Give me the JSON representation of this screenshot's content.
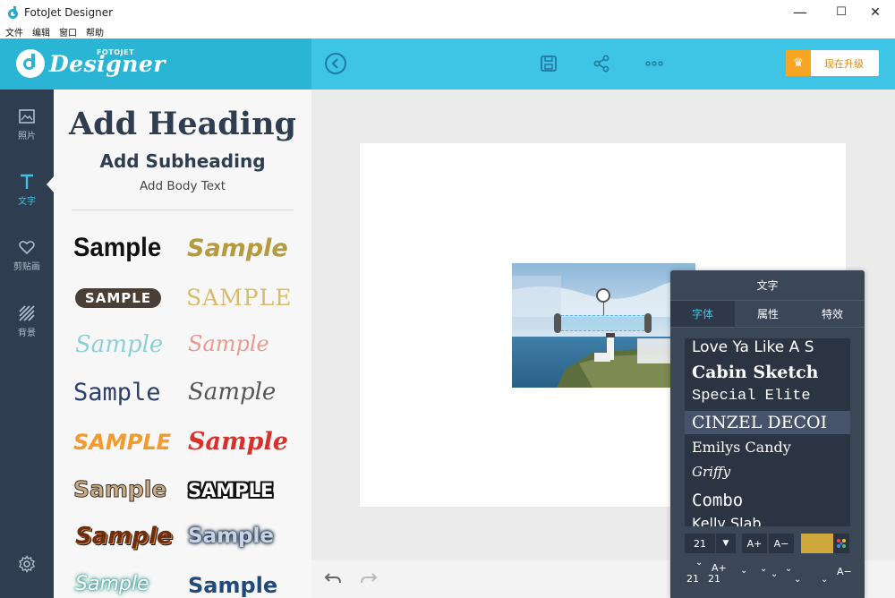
{
  "window": {
    "title": "FotoJet Designer",
    "minimize": "—",
    "maximize": "☐",
    "close": "✕"
  },
  "menu": [
    "文件",
    "编辑",
    "窗口",
    "帮助"
  ],
  "brand": {
    "name": "Designer",
    "sub": "FOTOJET",
    "color": "#2bb5d4"
  },
  "toolbar": {
    "back_icon": "chevron-left-icon",
    "save_icon": "save-icon",
    "share_icon": "share-icon",
    "more_icon": "more-icon",
    "upgrade_label": "现在升级",
    "upgrade_color": "#f6a623"
  },
  "rail": {
    "items": [
      {
        "icon": "image-icon",
        "label": "照片"
      },
      {
        "icon": "text-icon",
        "label": "文字"
      },
      {
        "icon": "heart-icon",
        "label": "剪贴画"
      },
      {
        "icon": "pattern-icon",
        "label": "背景"
      }
    ],
    "active": "文字",
    "settings_icon": "gear-icon"
  },
  "text_panel": {
    "heading": "Add Heading",
    "subheading": "Add Subheading",
    "body": "Add Body Text",
    "samples": [
      {
        "text": "Sample",
        "style": "bold-black"
      },
      {
        "text": "Sample",
        "style": "bold-gold"
      },
      {
        "text": "SAMPLE",
        "style": "outlined-brown"
      },
      {
        "text": "SAMPLE",
        "style": "serif-gold"
      },
      {
        "text": "Sample",
        "style": "script-teal"
      },
      {
        "text": "Sample",
        "style": "script-pink"
      },
      {
        "text": "Sample",
        "style": "marker-navy"
      },
      {
        "text": "Sample",
        "style": "calligraphy-gray"
      },
      {
        "text": "SAMPLE",
        "style": "brush-orange"
      },
      {
        "text": "Sample",
        "style": "brush-red"
      },
      {
        "text": "Sample",
        "style": "outline-tan"
      },
      {
        "text": "SAMPLE",
        "style": "outline-black-white"
      },
      {
        "text": "Sample",
        "style": "shadow-brown-orange"
      },
      {
        "text": "Sample",
        "style": "glow-blue"
      },
      {
        "text": "Sample",
        "style": "glow-teal"
      },
      {
        "text": "Sample",
        "style": "bold-navy"
      }
    ]
  },
  "text_popup": {
    "title": "文字",
    "tabs": [
      "字体",
      "属性",
      "特效"
    ],
    "active_tab": "字体",
    "fonts": [
      "Love Ya Like A S",
      "Cabin Sketch",
      "Special Elite",
      "CINZEL DECOI",
      "Emilys Candy",
      "Griffy",
      "Combo",
      "Kelly Slab"
    ],
    "selected_font": "CINZEL DECOI",
    "font_size": "21",
    "size_up": "A+",
    "size_down": "A−",
    "color": "#cfa83b",
    "row2_size_up": "A+",
    "row2_size_down": "A−",
    "row2_size_a": "21",
    "row2_size_b": "21"
  }
}
